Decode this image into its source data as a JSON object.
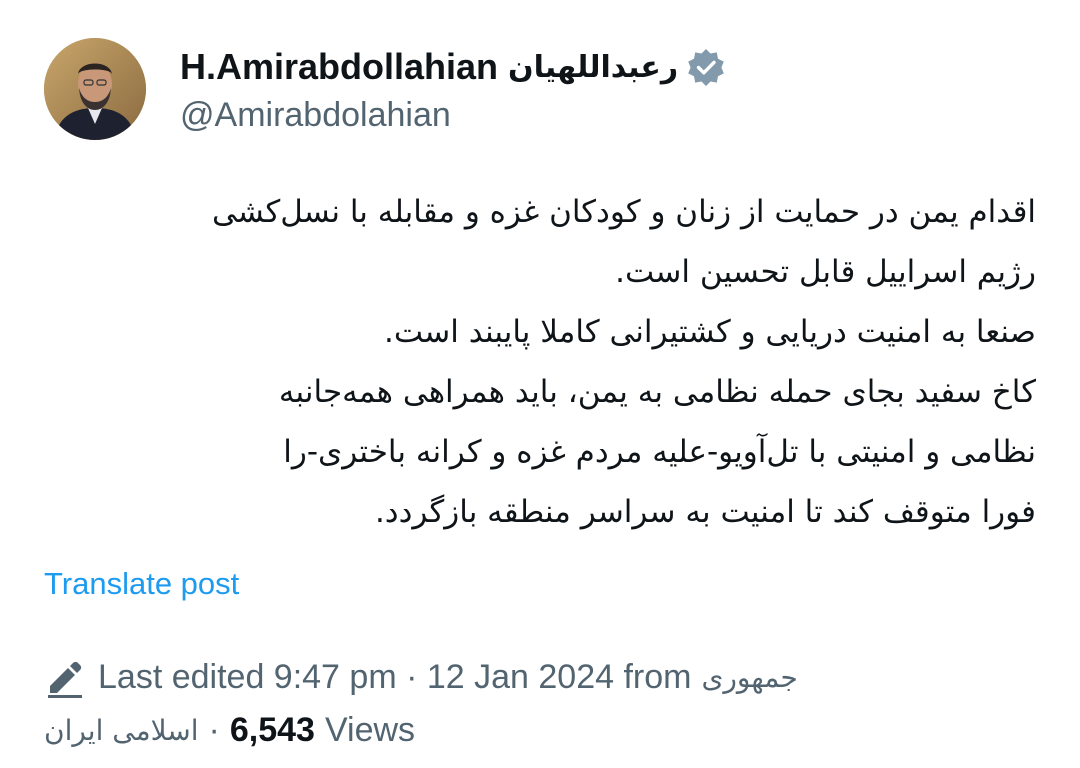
{
  "author": {
    "display_name_latin": "H.Amirabdollahian",
    "display_name_persian": "رعبداللهیان",
    "handle": "@Amirabdolahian",
    "verified": true,
    "verified_color": "#829aab"
  },
  "tweet": {
    "lines": [
      "اقدام یمن در حمایت از زنان و کودکان غزه و مقابله با نسل‌کشی",
      "رژیم اسراییل قابل تحسین است.",
      "صنعا به امنیت دریایی و کشتیرانی کاملا پایبند است.",
      "کاخ سفید بجای حمله نظامی به یمن، باید همراهی همه‌جانبه",
      "نظامی و امنیتی با تل‌آویو-علیه مردم غزه و کرانه باختری-را",
      "فورا متوقف کند تا امنیت به سراسر منطقه بازگردد."
    ]
  },
  "translate_label": "Translate post",
  "meta": {
    "edit_icon": "pencil-edit-icon",
    "edited_text": "Last edited 9:47 pm · 12 Jan 2024 from",
    "source_part1": "جمهوری",
    "source_part2": "اسلامی ایران",
    "separator": "·",
    "views_count": "6,543",
    "views_label": "Views"
  },
  "colors": {
    "text": "#0f1419",
    "secondary": "#536471",
    "link": "#1d9bf0"
  }
}
